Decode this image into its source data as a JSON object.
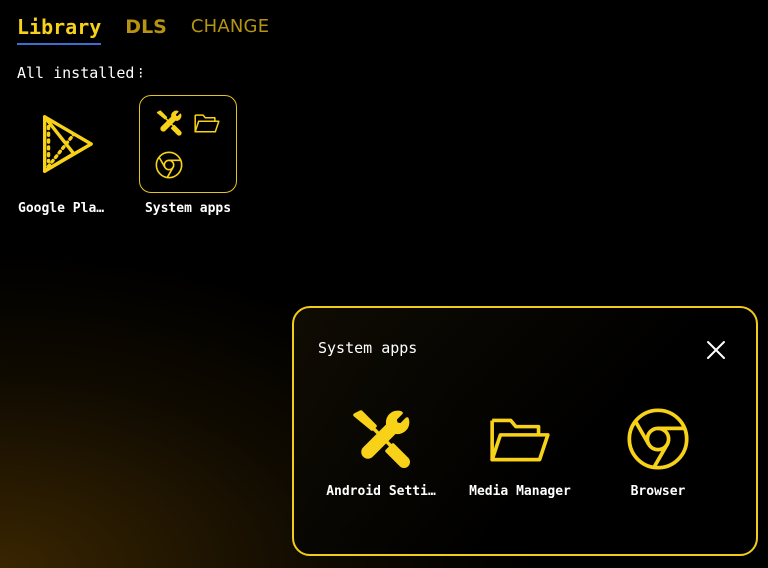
{
  "tabs": [
    {
      "label": "Library",
      "active": true
    },
    {
      "label": "DLS",
      "active": false
    },
    {
      "label": "CHANGE",
      "active": false
    }
  ],
  "filter": {
    "label": "All installed",
    "menu_glyph": "⁝"
  },
  "apps": [
    {
      "label": "Google Pla…",
      "icon": "play-store-icon"
    },
    {
      "label": "System apps",
      "icon": "folder-tile"
    }
  ],
  "dialog": {
    "title": "System apps",
    "apps": [
      {
        "label": "Android Setti…",
        "icon": "settings-tools-icon"
      },
      {
        "label": "Media Manager",
        "icon": "folder-icon"
      },
      {
        "label": "Browser",
        "icon": "chrome-icon"
      }
    ]
  },
  "colors": {
    "accent": "#f7d218",
    "tab_inactive": "#b59313",
    "underline": "#3a6fd0",
    "background": "#000000",
    "glow": "#5c3c02"
  }
}
